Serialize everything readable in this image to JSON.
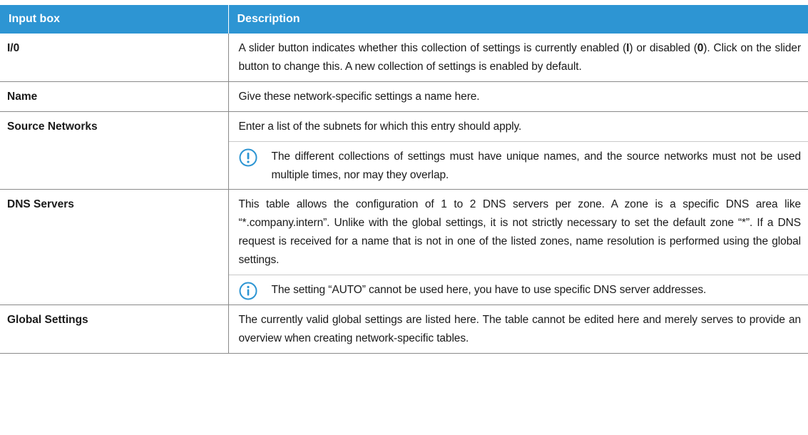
{
  "table": {
    "headers": [
      "Input box",
      "Description"
    ],
    "rows": [
      {
        "field": "I/0",
        "desc_parts": [
          "A slider button indicates whether this collection of settings is currently enabled (",
          "I",
          ") or disabled (",
          "0",
          "). Click on the slider button to change this. A new collection of settings is enabled by default."
        ]
      },
      {
        "field": "Name",
        "desc": "Give these network-specific settings a name here."
      },
      {
        "field": "Source Networks",
        "desc": "Enter a list of the subnets for which this entry should apply.",
        "note": {
          "icon": "exclamation-circle-icon",
          "text": "The different collections of settings must have unique names, and the source networks must not be used multiple times, nor may they overlap."
        }
      },
      {
        "field": "DNS Servers",
        "desc": "This table allows the configuration of 1 to 2 DNS servers per zone. A zone is a specific DNS area like “*.company.intern”. Unlike with the global settings, it is not strictly necessary to set the default zone “*”. If a DNS request is received for a name that is not in one of the listed zones, name resolution is performed using the global settings.",
        "note": {
          "icon": "info-circle-icon",
          "text": "The setting “AUTO” cannot be used here, you have to use specific DNS server addresses."
        }
      },
      {
        "field": "Global Settings",
        "desc": "The currently valid global settings are listed here. The table cannot be edited here and merely serves to provide an overview when creating network-specific tables."
      }
    ]
  },
  "colors": {
    "header_bg": "#2d95d3",
    "header_text": "#ffffff",
    "icon": "#2d95d3",
    "border": "#8a8a8a"
  }
}
